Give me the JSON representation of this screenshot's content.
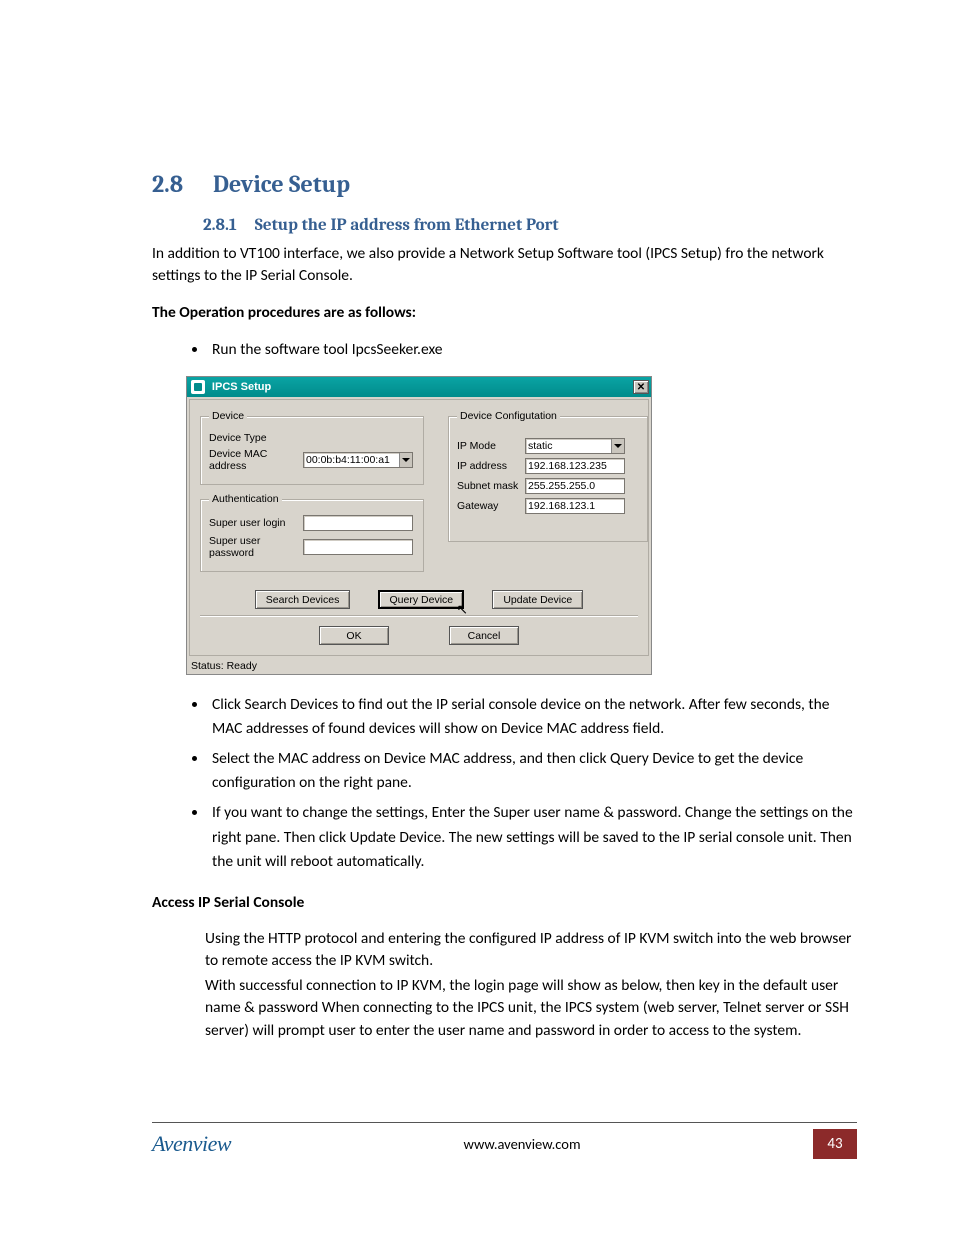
{
  "headings": {
    "h1_num": "2.8",
    "h1_text": "Device Setup",
    "h2_num": "2.8.1",
    "h2_text": "Setup the IP address from Ethernet Port"
  },
  "intro_para": "In addition to VT100 interface, we also provide a Network Setup Software tool (IPCS Setup) fro the network settings to the IP Serial Console.",
  "procedures_label": "The Operation procedures are as follows:",
  "bullet_run": "Run the software tool IpcsSeeker.exe",
  "screenshot": {
    "title": "IPCS Setup",
    "device": {
      "legend": "Device",
      "type_label": "Device Type",
      "mac_label": "Device MAC address",
      "mac_value": "00:0b:b4:11:00:a1"
    },
    "auth": {
      "legend": "Authentication",
      "login_label": "Super user login",
      "password_label": "Super user password"
    },
    "config": {
      "legend": "Device Configutation",
      "ipmode_label": "IP Mode",
      "ipmode_value": "static",
      "ipaddr_label": "IP address",
      "ipaddr_value": "192.168.123.235",
      "subnet_label": "Subnet mask",
      "subnet_value": "255.255.255.0",
      "gateway_label": "Gateway",
      "gateway_value": "192.168.123.1"
    },
    "buttons": {
      "search": "Search Devices",
      "query": "Query Device",
      "update": "Update Device",
      "ok": "OK",
      "cancel": "Cancel"
    },
    "status": "Status: Ready"
  },
  "bullets_after": [
    "Click Search Devices to find out the IP serial console device on the network. After few seconds, the MAC addresses of found devices will show on Device MAC address field.",
    "Select the MAC address on Device MAC address, and then click Query Device to get the device configuration on the right pane.",
    "If you want to change the settings, Enter the Super user name & password. Change the settings on the right pane. Then click Update Device. The new settings will be saved to the IP serial console unit. Then the unit will reboot automatically."
  ],
  "access_heading": "Access IP Serial Console",
  "access_para1": "Using the HTTP protocol and entering the configured IP address of IP KVM switch into the web browser to remote access the IP KVM switch.",
  "access_para2": "With successful connection to IP KVM, the login page will show as below, then key in the default user name & password When connecting to the IPCS unit, the IPCS system (web server, Telnet server or SSH server) will prompt user to enter the user name and password in order to access to the system.",
  "footer": {
    "logo": "Avenview",
    "url": "www.avenview.com",
    "page": "43"
  }
}
